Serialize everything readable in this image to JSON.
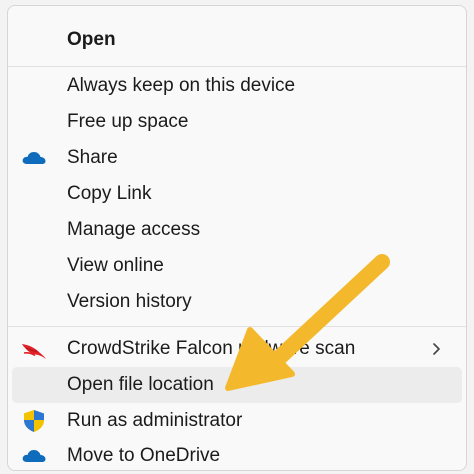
{
  "menu": {
    "open": "Open",
    "always_keep": "Always keep on this device",
    "free_up": "Free up space",
    "share": "Share",
    "copy_link": "Copy Link",
    "manage_access": "Manage access",
    "view_online": "View online",
    "version_history": "Version history",
    "crowdstrike": "CrowdStrike Falcon malware scan",
    "open_location": "Open file location",
    "run_admin": "Run as administrator",
    "move_onedrive": "Move to OneDrive"
  },
  "icons": {
    "share": "onedrive-cloud-icon",
    "crowdstrike": "crowdstrike-falcon-icon",
    "run_admin": "uac-shield-icon",
    "move_onedrive": "onedrive-cloud-icon",
    "submenu": "chevron-right-icon"
  },
  "colors": {
    "onedrive_blue": "#0f6cbd",
    "crowdstrike_red": "#e01f26",
    "annotation_arrow": "#f4b82c"
  }
}
